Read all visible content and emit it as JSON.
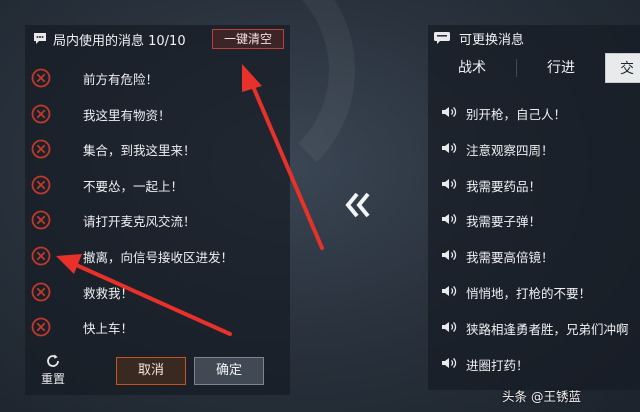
{
  "left_panel": {
    "title": "局内使用的消息 10/10",
    "clear_all": "一键清空",
    "messages": [
      "前方有危险！",
      "我这里有物资！",
      "集合，到我这里来！",
      "不要怂，一起上！",
      "请打开麦克风交流！",
      "撤离，向信号接收区进发！",
      "救救我！",
      "快上车！"
    ],
    "reset_label": "重置",
    "cancel_label": "取消",
    "confirm_label": "确定"
  },
  "right_panel": {
    "title": "可更换消息",
    "tabs": [
      "战术",
      "行进",
      "交"
    ],
    "active_tab": 2,
    "messages": [
      "别开枪，自己人！",
      "注意观察四周！",
      "我需要药品！",
      "我需要子弹！",
      "我需要高倍镜！",
      "悄悄地，打枪的不要！",
      "狭路相逢勇者胜，兄弟们冲啊",
      "进圈打药！"
    ]
  },
  "watermark": "头条 @王锈蓝",
  "colors": {
    "remove_red": "#c0392b",
    "annotation_red": "#e8312a",
    "cancel_border": "#c4541c"
  },
  "icons": {
    "left_header": "chat-bubble-icon",
    "remove": "remove-x-icon",
    "reset": "refresh-icon",
    "transfer": "double-chevron-left-icon",
    "right_header": "message-bubble-icon",
    "message": "speaker-icon"
  }
}
